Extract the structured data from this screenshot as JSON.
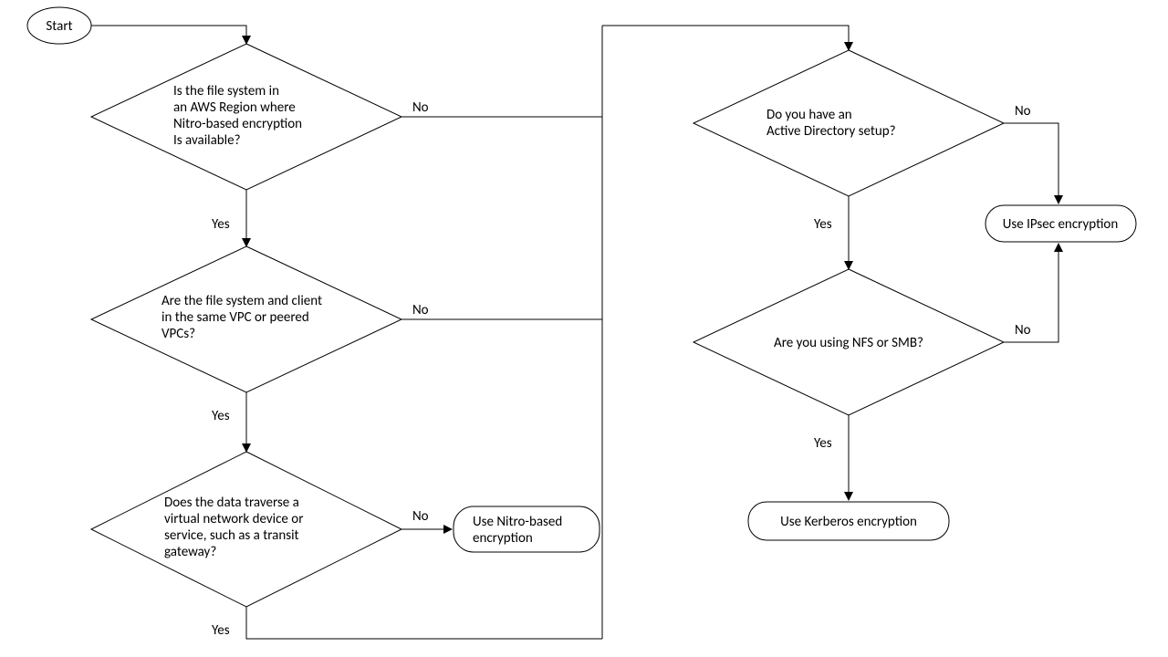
{
  "flowchart": {
    "start": "Start",
    "decisions": {
      "d1": {
        "lines": [
          "Is the file system in",
          "an AWS Region where",
          "Nitro-based encryption",
          "Is available?"
        ]
      },
      "d2": {
        "lines": [
          "Are the file system and client",
          "in the same VPC or peered",
          "VPCs?"
        ]
      },
      "d3": {
        "lines": [
          "Does the data traverse a",
          "virtual network  device or",
          "service, such as a transit",
          "gateway?"
        ]
      },
      "d4": {
        "lines": [
          "Do you have an",
          "Active Directory setup?"
        ]
      },
      "d5": {
        "lines": [
          "Are you using NFS or SMB?"
        ]
      }
    },
    "terminals": {
      "t_nitro": {
        "lines": [
          "Use Nitro-based",
          "encryption"
        ]
      },
      "t_ipsec": "Use IPsec encryption",
      "t_kerb": "Use Kerberos encryption"
    },
    "labels": {
      "yes": "Yes",
      "no": "No"
    }
  }
}
